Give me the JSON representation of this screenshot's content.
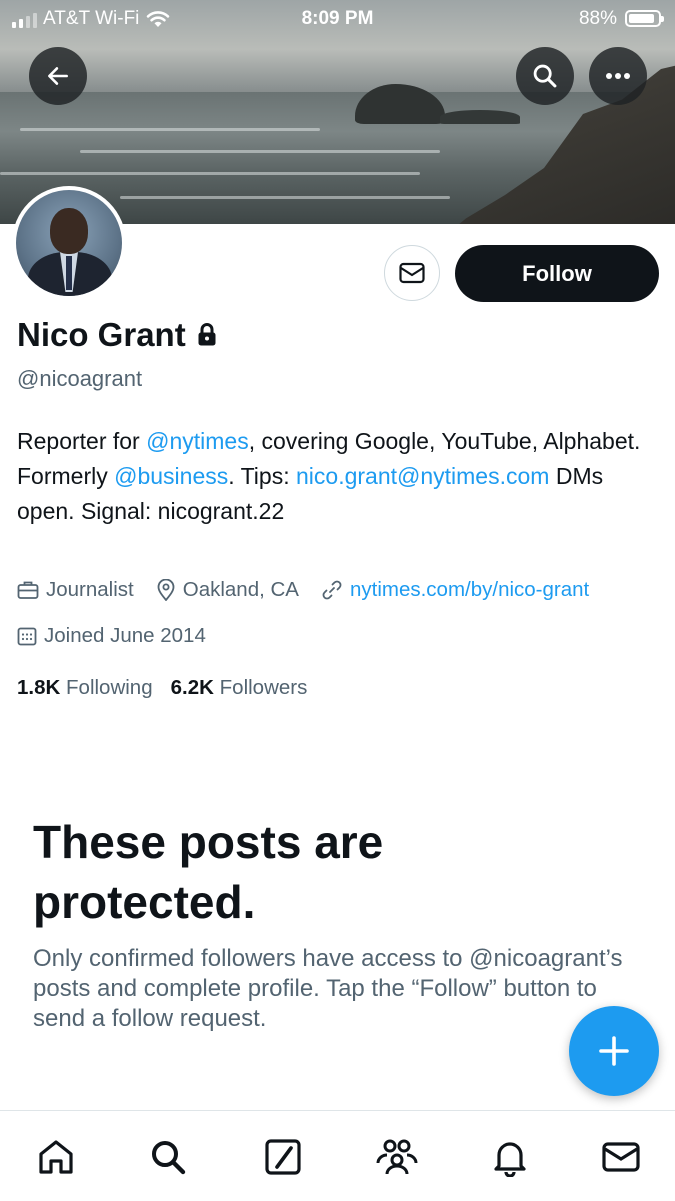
{
  "status_bar": {
    "carrier": "AT&T Wi-Fi",
    "time": "8:09 PM",
    "battery_percent": "88%",
    "battery_level": 0.88
  },
  "header": {
    "icons": [
      "arrow-left-icon",
      "search-icon",
      "more-icon"
    ]
  },
  "profile": {
    "name": "Nico Grant",
    "handle": "@nicoagrant",
    "follow_label": "Follow",
    "bio": {
      "p1": "Reporter for ",
      "m1": "@nytimes",
      "p2": ", covering Google, YouTube, Alphabet. Formerly ",
      "m2": "@business",
      "p3": ". Tips: ",
      "email": "nico.grant@nytimes.com",
      "p4": " DMs open. Signal: nicogrant.22"
    },
    "occupation": "Journalist",
    "location": "Oakland, CA",
    "website": "nytimes.com/by/nico-grant",
    "joined": "Joined June 2014",
    "following_count": "1.8K",
    "following_label": "Following",
    "followers_count": "6.2K",
    "followers_label": "Followers"
  },
  "protected": {
    "title": "These posts are protected.",
    "text": "Only confirmed followers have access to @nicoagrant’s posts and complete profile. Tap the “Follow” button to send a follow request."
  },
  "tabbar": {
    "items": [
      "home-icon",
      "search-icon",
      "compose-icon",
      "communities-icon",
      "notifications-icon",
      "messages-icon"
    ]
  },
  "colors": {
    "accent": "#1d9bf0",
    "text": "#0f1419",
    "secondary": "#536471"
  }
}
